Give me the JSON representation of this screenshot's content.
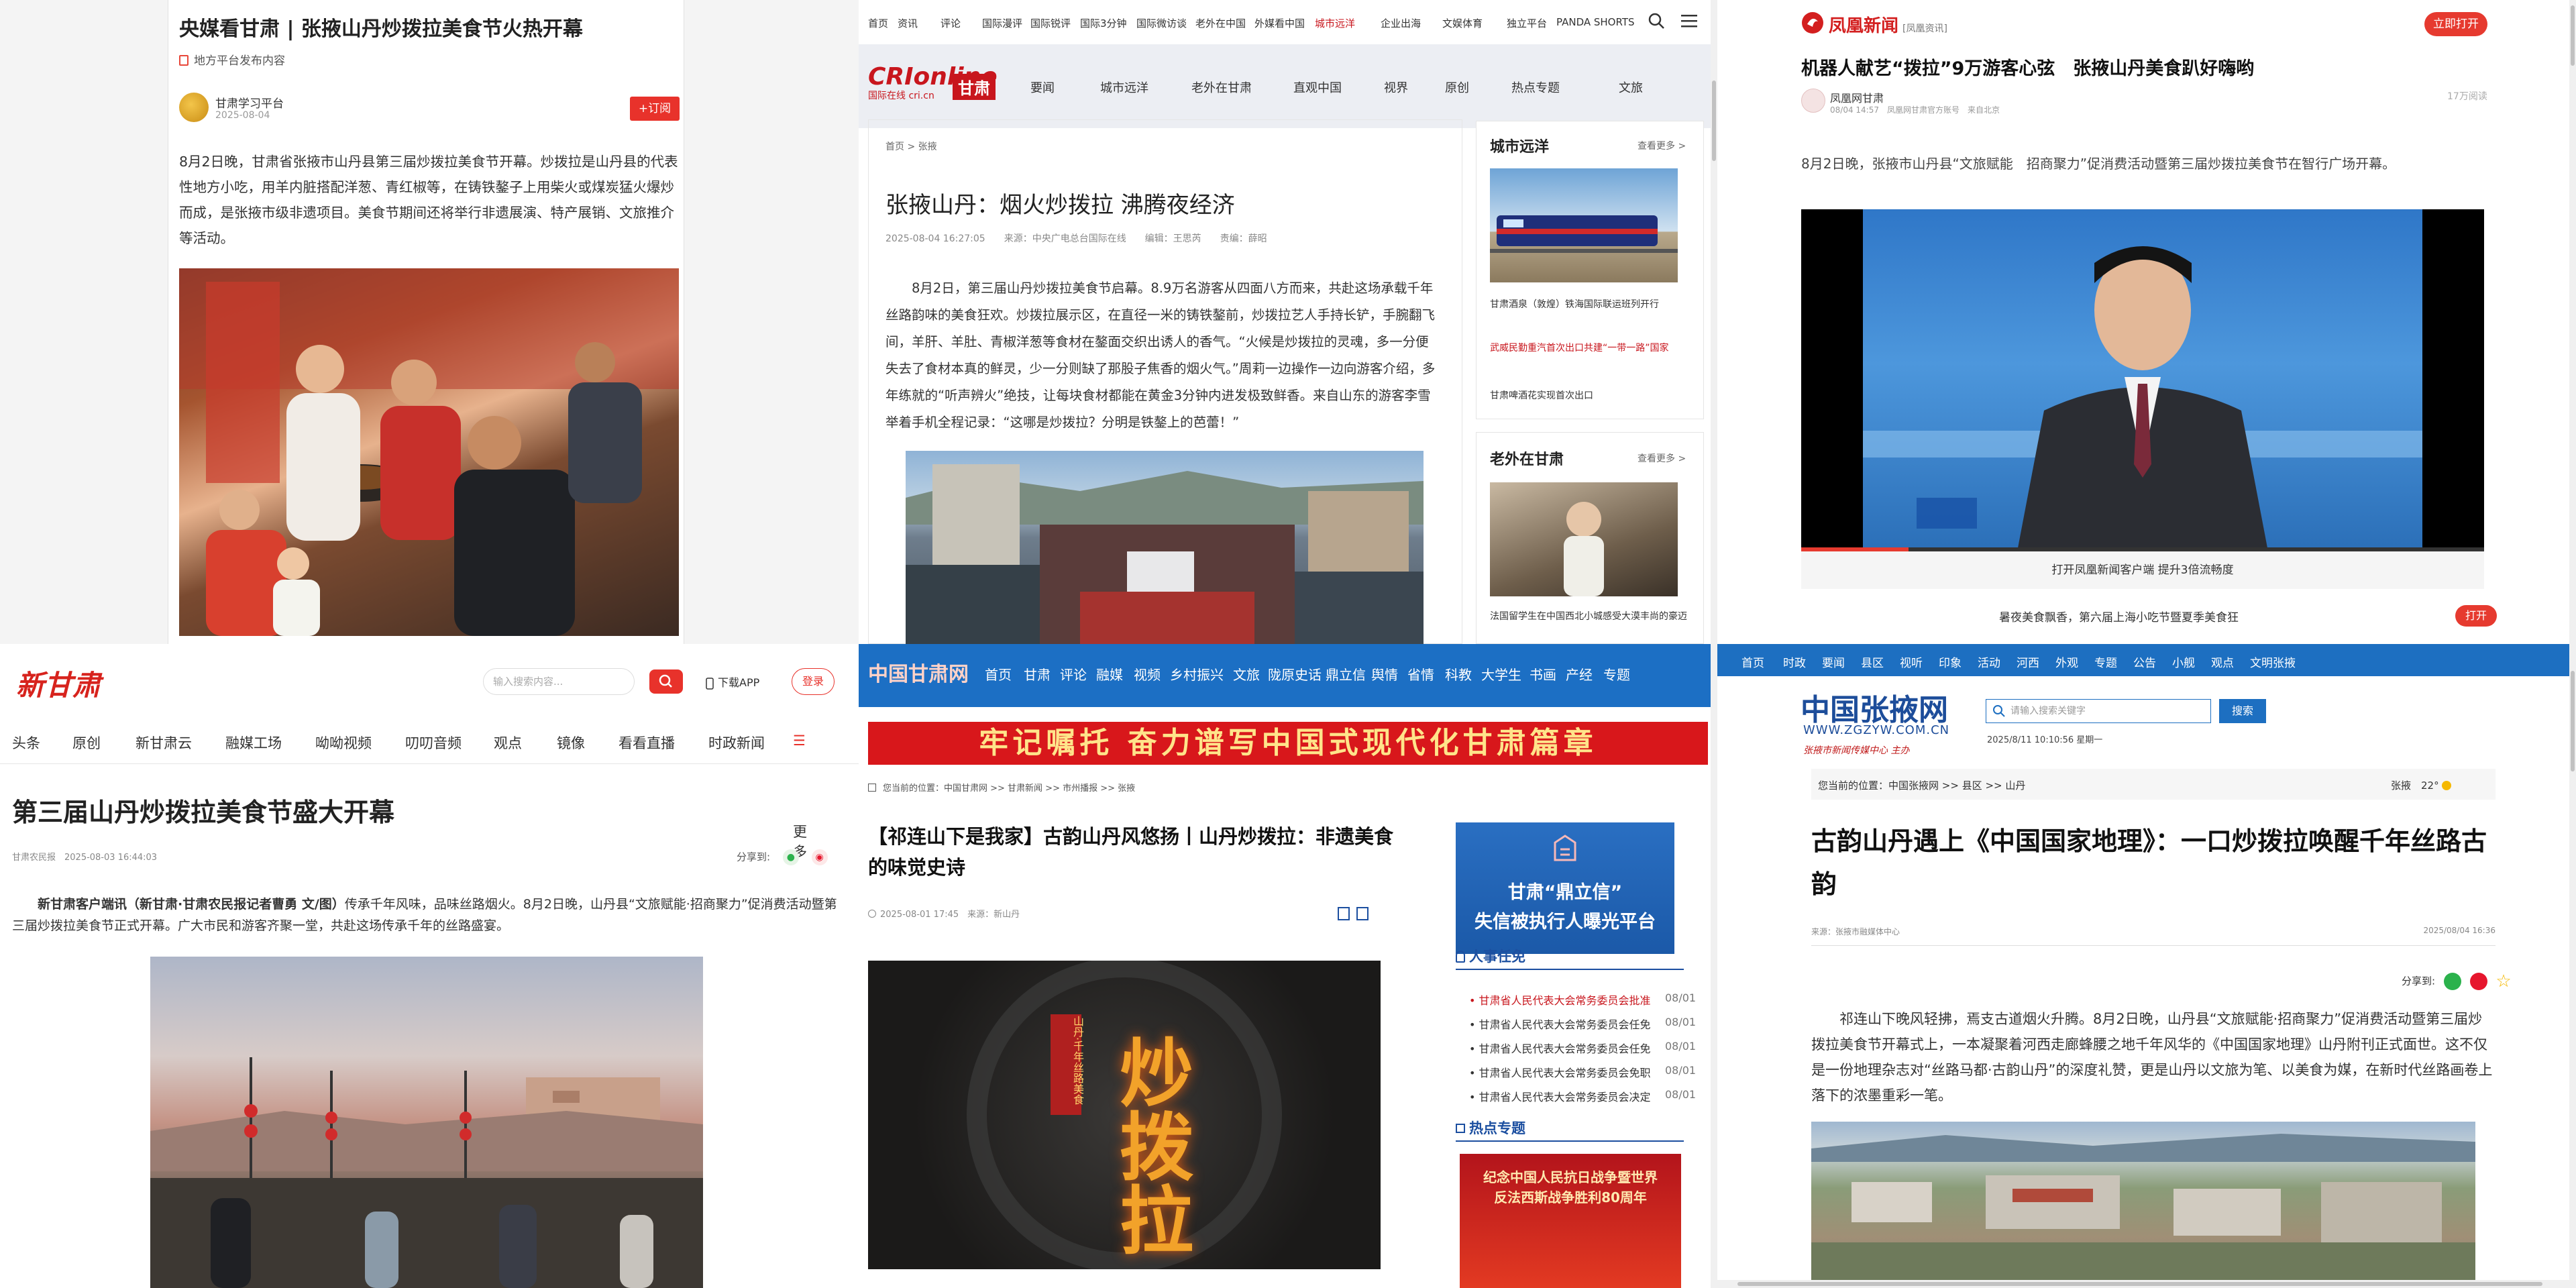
{
  "p1": {
    "title": "央媒看甘肃 | 张掖山丹炒拨拉美食节火热开幕",
    "source_tag": "地方平台发布内容",
    "account": "甘肃学习平台",
    "date": "2025-08-04",
    "follow": "+订阅",
    "body": "8月2日晚，甘肃省张掖市山丹县第三届炒拨拉美食节开幕。炒拨拉是山丹县的代表性地方小吃，用羊内脏搭配洋葱、青红椒等，在铸铁鏊子上用柴火或煤炭猛火爆炒而成，是张掖市级非遗项目。美食节期间还将举行非遗展演、特产展销、文旅推介等活动。"
  },
  "p2": {
    "topnav": [
      "首页",
      "资讯",
      "评论",
      "国际漫评",
      "国际锐评",
      "国际3分钟",
      "国际微访谈",
      "老外在中国",
      "外媒看中国",
      "城市远洋",
      "企业出海",
      "文娱体育",
      "独立平台",
      "PANDA SHORTS"
    ],
    "logo": "CRIonline",
    "logo_sub": "国际在线 cri.cn",
    "region": "甘肃",
    "menu": [
      "要闻",
      "城市远洋",
      "老外在甘肃",
      "直观中国",
      "视界",
      "原创",
      "热点专题",
      "文旅"
    ],
    "breadcrumb": "首页 > 张掖",
    "title": "张掖山丹：烟火炒拨拉 沸腾夜经济",
    "meta": "2025-08-04 16:27:05　　来源：中央广电总台国际在线　　编辑：王思芮　　责编：薛昭",
    "body": "8月2日，第三届山丹炒拨拉美食节启幕。8.9万名游客从四面八方而来，共赴这场承载千年丝路韵味的美食狂欢。炒拨拉展示区，在直径一米的铸铁鏊前，炒拨拉艺人手持长铲，手腕翻飞间，羊肝、羊肚、青椒洋葱等食材在鏊面交织出诱人的香气。“火候是炒拨拉的灵魂，多一分便失去了食材本真的鲜灵，少一分则缺了那股子焦香的烟火气。”周莉一边操作一边向游客介绍，多年练就的“听声辨火”绝技，让每块食材都能在黄金3分钟内进发极致鲜香。来自山东的游客李雪举着手机全程记录：“这哪是炒拨拉？分明是铁鏊上的芭蕾！”",
    "side1_title": "城市远洋",
    "side_more": "查看更多 >",
    "side1_caption": "甘肃酒泉（敦煌）铁海国际联运班列开行",
    "side1_red": "武威民勤重汽首次出口共建“一带一路”国家",
    "side1_item2": "甘肃啤酒花实现首次出口",
    "side2_title": "老外在甘肃",
    "side2_caption": "法国留学生在中国西北小城感受大漠丰尚的豪迈"
  },
  "p3": {
    "logo": "凤凰新闻",
    "logo_sub": "[凤凰资讯]",
    "open_btn": "立即打开",
    "title": "机器人献艺“拨拉”9万游客心弦　张掖山丹美食趴好嗨哟",
    "source": "凤凰网甘肃",
    "source_meta": "08/04 14:57　凤凰网甘肃官方账号　来自北京",
    "reads": "17万阅读",
    "para": "8月2日晚，张掖市山丹县“文旅赋能　招商聚力”促消费活动暨第三届炒拨拉美食节在智行广场开幕。",
    "video_caption": "打开凤凰新闻客户端 提升3倍流畅度",
    "promo": "暑夜美食飘香，第六届上海小吃节暨夏季美食狂",
    "promo_btn": "打开"
  },
  "p4": {
    "logo": "新甘肃",
    "search_placeholder": "输入搜索内容...",
    "download": "下载APP",
    "login": "登录",
    "nav": [
      "头条",
      "原创",
      "新甘肃云",
      "融媒工场",
      "呦呦视频",
      "叨叨音频",
      "观点",
      "镜像",
      "看看直播",
      "时政新闻",
      "更多"
    ],
    "title": "第三届山丹炒拨拉美食节盛大开幕",
    "meta": "甘肃农民报　2025-08-03 16:44:03",
    "share": "分享到:",
    "body_bold": "新甘肃客户端讯（新甘肃·甘肃农民报记者曹勇 文/图）",
    "body": "传承千年风味，品味丝路烟火。8月2日晚，山丹县“文旅赋能·招商聚力”促消费活动暨第三届炒拨拉美食节正式开幕。广大市民和游客齐聚一堂，共赴这场传承千年的丝路盛宴。"
  },
  "p5": {
    "logo": "中国甘肃网",
    "nav": [
      "首页",
      "甘肃",
      "评论",
      "融媒",
      "视频",
      "乡村振兴",
      "文旅",
      "陇原史话",
      "鼎立信",
      "舆情",
      "省情",
      "科教",
      "大学生",
      "书画",
      "产经",
      "专题"
    ],
    "banner": "牢记嘱托 奋力谱写中国式现代化甘肃篇章",
    "position": "您当前的位置：中国甘肃网 >> 甘肃新闻 >> 市州播报 >> 张掖",
    "title": "【祁连山下是我家】古韵山丹风悠扬丨山丹炒拨拉：非遗美食的味觉史诗",
    "meta": "2025-08-01 17:45　来源：新山丹",
    "ad_line1": "甘肃“鼎立信”",
    "ad_line2": "失信被执行人曝光平台",
    "hr_title": "人事任免",
    "hr_items": [
      {
        "t": "甘肃省人民代表大会常务委员会批准",
        "d": "08/01"
      },
      {
        "t": "甘肃省人民代表大会常务委员会任免",
        "d": "08/01"
      },
      {
        "t": "甘肃省人民代表大会常务委员会任免",
        "d": "08/01"
      },
      {
        "t": "甘肃省人民代表大会常务委员会免职",
        "d": "08/01"
      },
      {
        "t": "甘肃省人民代表大会常务委员会决定",
        "d": "08/01"
      }
    ],
    "hot_title": "热点专题",
    "hot_banner": "纪念中国人民抗日战争暨世界反法西斯战争胜利80周年",
    "video_text": "炒拨拉",
    "video_sub": "山丹·千年丝路美食"
  },
  "p6": {
    "nav": [
      "首页",
      "时政",
      "要闻",
      "县区",
      "视听",
      "印象",
      "活动",
      "河西",
      "外观",
      "专题",
      "公告",
      "小舰",
      "观点",
      "文明张掖"
    ],
    "logo": "中国张掖网",
    "url": "WWW.ZGZYW.COM.CN",
    "slogan": "张掖市新闻传媒中心 主办",
    "search_placeholder": "请输入搜索关键字",
    "search_btn": "搜索",
    "date": "2025/8/11 10:10:56 星期一",
    "position": "您当前的位置：中国张掖网 >> 县区 >> 山丹",
    "weather": "张掖　22°",
    "title": "古韵山丹遇上《中国国家地理》：一口炒拨拉唤醒千年丝路古韵",
    "source": "来源：张掖市融媒体中心",
    "pubdate": "2025/08/04 16:36",
    "share": "分享到:",
    "body": "祁连山下晚风轻拂，焉支古道烟火升腾。8月2日晚，山丹县“文旅赋能·招商聚力”促消费活动暨第三届炒拨拉美食节开幕式上，一本凝聚着河西走廊蜂腰之地千年风华的《中国国家地理》山丹附刊正式面世。这不仅是一份地理杂志对“丝路马都·古韵山丹”的深度礼赞，更是山丹以文旅为笔、以美食为媒，在新时代丝路画卷上落下的浓墨重彩一笔。"
  }
}
